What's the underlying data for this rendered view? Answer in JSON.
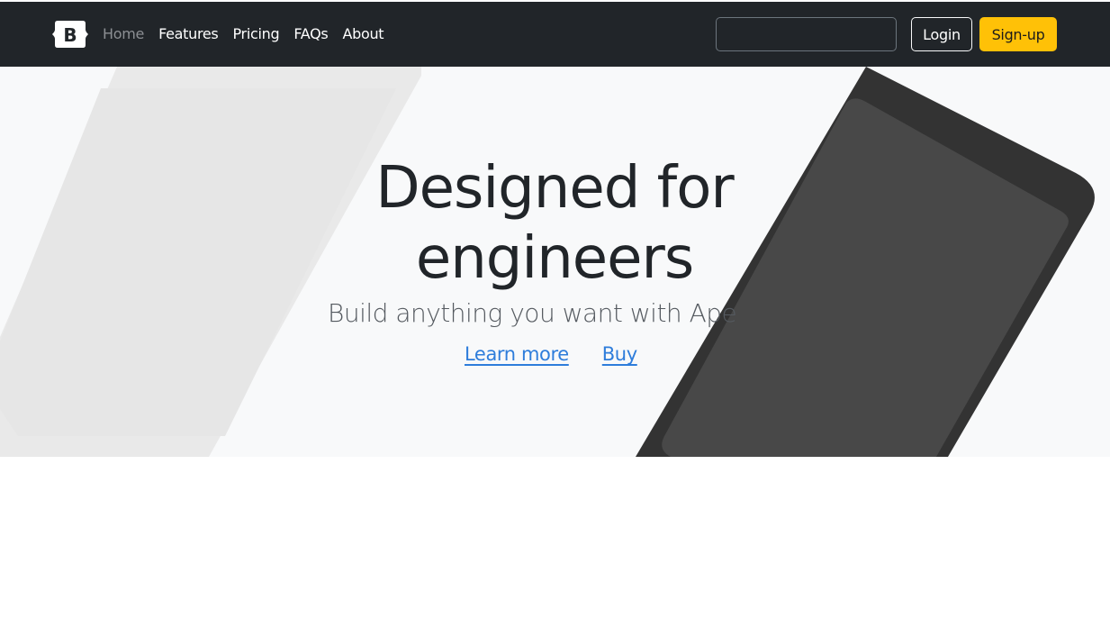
{
  "navbar": {
    "brand_letter": "B",
    "links": [
      {
        "label": "Home",
        "active": true
      },
      {
        "label": "Features",
        "active": false
      },
      {
        "label": "Pricing",
        "active": false
      },
      {
        "label": "FAQs",
        "active": false
      },
      {
        "label": "About",
        "active": false
      }
    ],
    "search": {
      "value": "",
      "placeholder": ""
    },
    "login_label": "Login",
    "signup_label": "Sign-up"
  },
  "hero": {
    "title": "Designed for engineers",
    "subtitle": "Build anything you want with Ape",
    "links": [
      {
        "label": "Learn more"
      },
      {
        "label": "Buy"
      }
    ]
  },
  "colors": {
    "navbar_bg": "#212529",
    "hero_bg": "#f8f9fa",
    "signup_bg": "#ffc107",
    "link": "#2e7ddb",
    "device_dark": "#333333",
    "device_dark_screen": "#484848",
    "device_light": "#e9e9e9"
  }
}
